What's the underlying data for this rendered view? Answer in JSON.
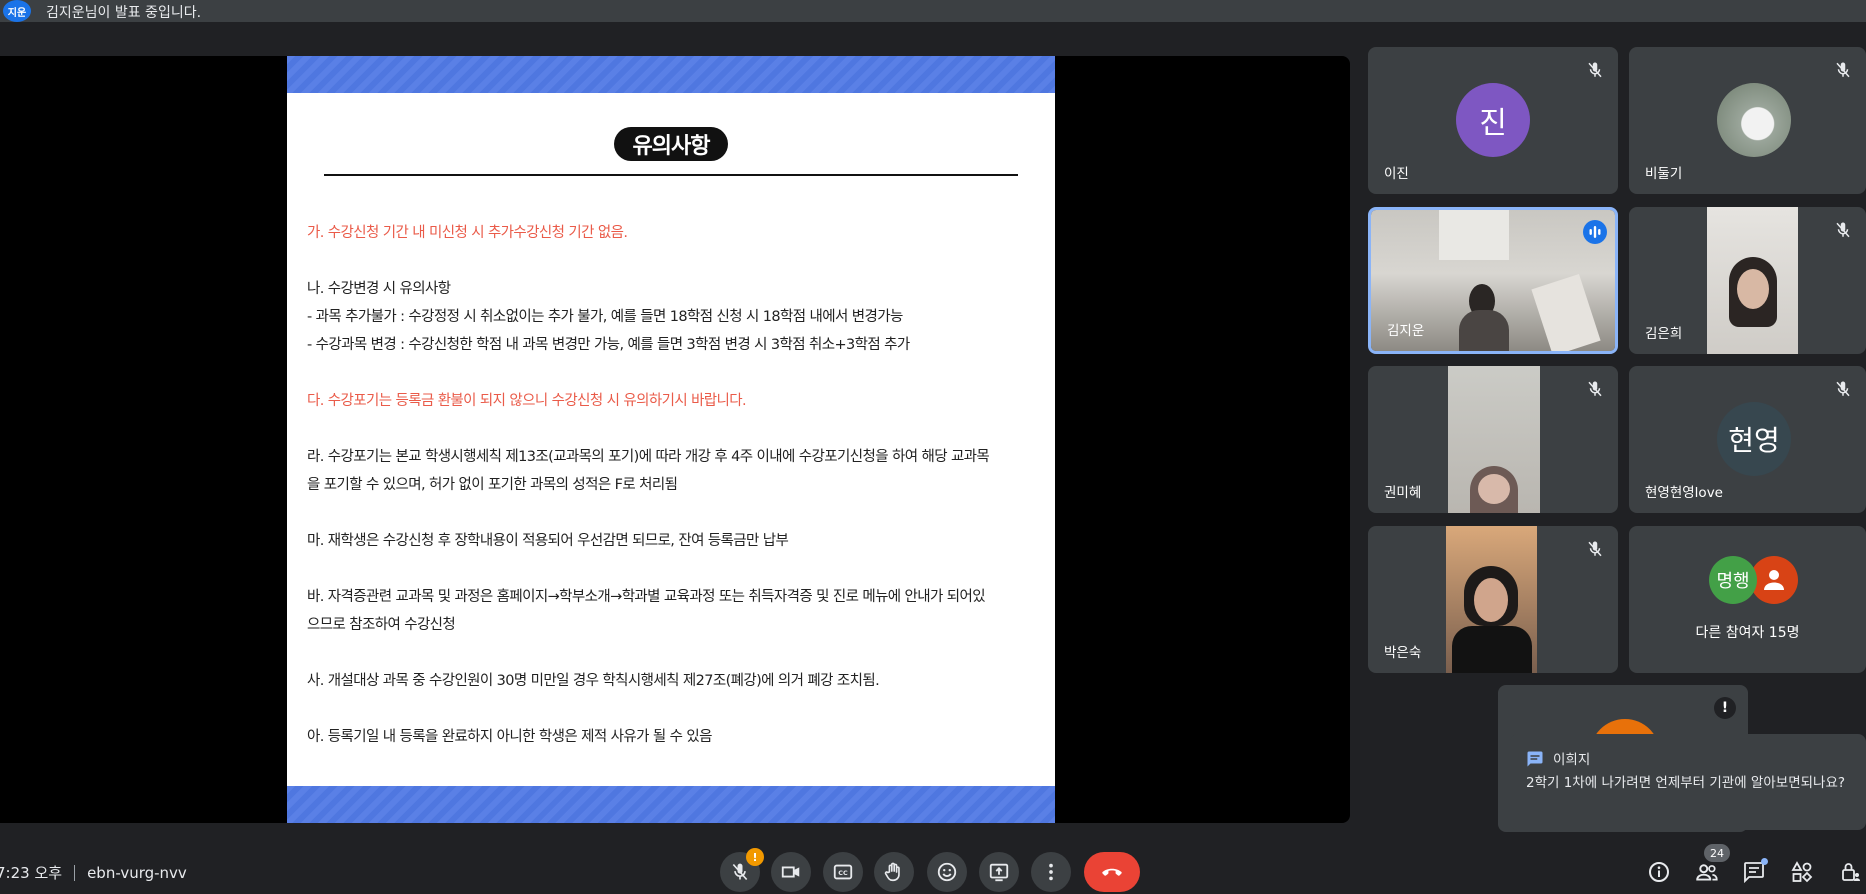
{
  "banner": {
    "presenter_initials": "지운",
    "presenting_text": "김지운님이 발표 중입니다."
  },
  "slide": {
    "title": "유의사항",
    "lines": [
      {
        "text": "가. 수강신청 기간 내 미신청 시 추가수강신청 기간 없음.",
        "color": "#ea5b49"
      },
      {
        "text": "나. 수강변경 시 유의사항",
        "color": "#222222"
      },
      {
        "text": "- 과목 추가불가 : 수강정정 시 취소없이는 추가 불가, 예를 들면 18학점 신청 시 18학점 내에서 변경가능",
        "color": "#222222"
      },
      {
        "text": "- 수강과목 변경 : 수강신청한 학점 내 과목 변경만 가능, 예를 들면 3학점 변경 시 3학점 취소+3학점 추가",
        "color": "#222222"
      },
      {
        "text": "다. 수강포기는 등록금 환불이 되지 않으니 수강신청 시 유의하기시 바랍니다.",
        "color": "#ea5b49"
      },
      {
        "text": "라. 수강포기는 본교 학생시행세칙 제13조(교과목의 포기)에 따라 개강 후 4주 이내에 수강포기신청을 하여 해당 교과목",
        "color": "#222222"
      },
      {
        "text": "을 포기할 수 있으며, 허가 없이 포기한 과목의 성적은 F로 처리됨",
        "color": "#222222"
      },
      {
        "text": "마. 재학생은 수강신청 후 장학내용이 적용되어 우선감면 되므로, 잔여 등록금만 납부",
        "color": "#222222"
      },
      {
        "text": "바. 자격증관련 교과목 및 과정은 홈페이지→학부소개→학과별 교육과정 또는 취득자격증 및 진로 메뉴에 안내가 되어있",
        "color": "#222222"
      },
      {
        "text": "으므로 참조하여 수강신청",
        "color": "#222222"
      },
      {
        "text": "사. 개설대상 과목 중 수강인원이 30명 미만일 경우 학칙시행세칙 제27조(폐강)에 의거 폐강 조치됨.",
        "color": "#222222"
      },
      {
        "text": "아. 등록기일 내 등록을 완료하지 아니한 학생은 제적 사유가 될 수 있음",
        "color": "#222222"
      }
    ]
  },
  "participants": [
    {
      "name": "이진",
      "avatar_text": "진",
      "avatar_color": "#7e57c2",
      "muted": true
    },
    {
      "name": "비둘기",
      "avatar_text": "",
      "avatar_color": "#8a9a8a",
      "muted": true
    },
    {
      "name": "김지운",
      "muted": false,
      "speaking": true
    },
    {
      "name": "김은희",
      "muted": true
    },
    {
      "name": "권미혜",
      "muted": true
    },
    {
      "name": "현영현영love",
      "avatar_text": "현영",
      "avatar_color": "#37474f",
      "muted": true
    },
    {
      "name": "박은숙",
      "muted": true
    },
    {
      "name": "다른 참여자 15명",
      "avatar_text": "명행",
      "avatar_color": "#43a047",
      "second_avatar_color": "#d84315"
    }
  ],
  "chat_toast": {
    "sender": "이희지",
    "message": "2학기 1차에 나가려면 언제부터 기관에 알아보면되나요?"
  },
  "bottom_bar": {
    "time": "7:23 오후",
    "meeting_code": "ebn-vurg-nvv",
    "participant_count": "24",
    "warning_badge": "!"
  },
  "colors": {
    "background": "#202124",
    "tile": "#3c4043",
    "end_call": "#ea4335",
    "accent": "#8ab4f8"
  }
}
